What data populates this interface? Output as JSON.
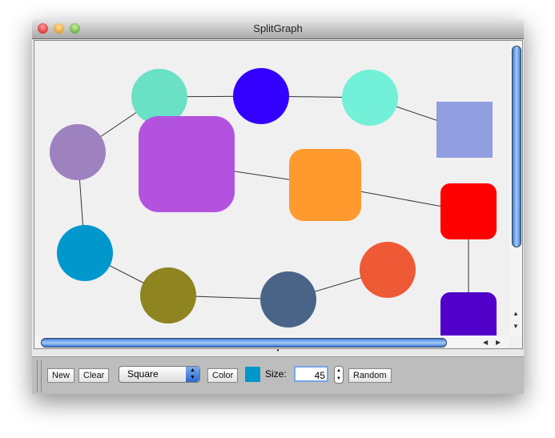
{
  "window": {
    "title": "SplitGraph"
  },
  "graph": {
    "nodes": [
      {
        "shape": "circle",
        "color": "#6ae0c4"
      },
      {
        "shape": "circle",
        "color": "#3300ff"
      },
      {
        "shape": "circle",
        "color": "#72f0d8"
      },
      {
        "shape": "square",
        "color": "#919ee0"
      },
      {
        "shape": "circle",
        "color": "#9e82c0"
      },
      {
        "shape": "rounded",
        "color": "#b452e0"
      },
      {
        "shape": "rounded",
        "color": "#ff9a2e"
      },
      {
        "shape": "rounded",
        "color": "#ff0000"
      },
      {
        "shape": "circle",
        "color": "#0098cc"
      },
      {
        "shape": "circle",
        "color": "#8e8420"
      },
      {
        "shape": "circle",
        "color": "#4a6488"
      },
      {
        "shape": "circle",
        "color": "#ee5a36"
      },
      {
        "shape": "rounded",
        "color": "#5000c8"
      }
    ],
    "edges": [
      [
        4,
        0
      ],
      [
        0,
        1
      ],
      [
        1,
        2
      ],
      [
        2,
        3
      ],
      [
        4,
        8
      ],
      [
        8,
        9
      ],
      [
        9,
        10
      ],
      [
        10,
        11
      ],
      [
        5,
        6
      ],
      [
        6,
        7
      ],
      [
        7,
        12
      ]
    ]
  },
  "toolbar": {
    "new_label": "New",
    "clear_label": "Clear",
    "shape_value": "Square",
    "color_label": "Color",
    "color_value": "#0098cc",
    "size_label": "Size:",
    "size_value": "45",
    "random_label": "Random"
  }
}
